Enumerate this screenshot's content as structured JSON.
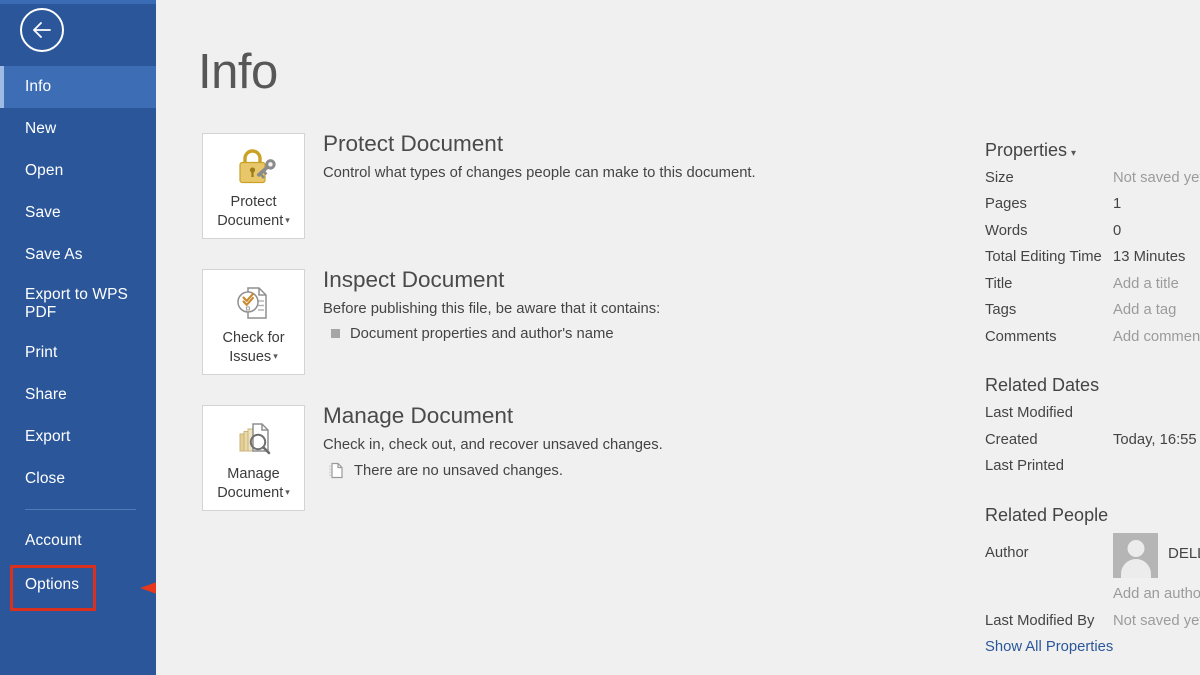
{
  "app": {
    "back_button_icon": "back-arrow-icon",
    "page_title": "Info"
  },
  "sidebar": {
    "items": [
      {
        "label": "Info",
        "active": true
      },
      {
        "label": "New",
        "active": false
      },
      {
        "label": "Open",
        "active": false
      },
      {
        "label": "Save",
        "active": false
      },
      {
        "label": "Save As",
        "active": false
      },
      {
        "label": "Export to WPS PDF",
        "active": false
      },
      {
        "label": "Print",
        "active": false
      },
      {
        "label": "Share",
        "active": false
      },
      {
        "label": "Export",
        "active": false
      },
      {
        "label": "Close",
        "active": false
      }
    ],
    "bottom_items": [
      {
        "label": "Account"
      },
      {
        "label": "Options"
      }
    ]
  },
  "annotation": {
    "highlight_target": "Options",
    "highlight_color": "#d9301f",
    "arrow_color": "#e8381b",
    "arrow_direction": "left"
  },
  "main": {
    "blocks": [
      {
        "tile_caption": "Protect\nDocument",
        "tile_icon": "lock-and-key-icon",
        "heading": "Protect Document",
        "description": "Control what types of changes people can make to this document.",
        "bullets": []
      },
      {
        "tile_caption": "Check for\nIssues",
        "tile_icon": "document-check-icon",
        "heading": "Inspect Document",
        "description": "Before publishing this file, be aware that it contains:",
        "bullets": [
          {
            "icon": "square-bullet-icon",
            "text": "Document properties and author's name"
          }
        ]
      },
      {
        "tile_caption": "Manage\nDocument",
        "tile_icon": "documents-magnifier-icon",
        "heading": "Manage Document",
        "description": "Check in, check out, and recover unsaved changes.",
        "bullets": [
          {
            "icon": "document-page-icon",
            "text": "There are no unsaved changes."
          }
        ]
      }
    ]
  },
  "properties": {
    "title": "Properties",
    "rows": [
      {
        "key": "Size",
        "value": "Not saved yet",
        "muted": true
      },
      {
        "key": "Pages",
        "value": "1",
        "muted": false
      },
      {
        "key": "Words",
        "value": "0",
        "muted": false
      },
      {
        "key": "Total Editing Time",
        "value": "13 Minutes",
        "muted": false
      },
      {
        "key": "Title",
        "value": "Add a title",
        "muted": true
      },
      {
        "key": "Tags",
        "value": "Add a tag",
        "muted": true
      },
      {
        "key": "Comments",
        "value": "Add comments",
        "muted": true
      }
    ]
  },
  "related_dates": {
    "title": "Related Dates",
    "rows": [
      {
        "key": "Last Modified",
        "value": "",
        "muted": false
      },
      {
        "key": "Created",
        "value": "Today, 16:55",
        "muted": false
      },
      {
        "key": "Last Printed",
        "value": "",
        "muted": false
      }
    ]
  },
  "related_people": {
    "title": "Related People",
    "author_key": "Author",
    "author_name": "DELL",
    "add_author": "Add an author",
    "last_modified_by_key": "Last Modified By",
    "last_modified_by_value": "Not saved yet",
    "show_all_link": "Show All Properties"
  }
}
